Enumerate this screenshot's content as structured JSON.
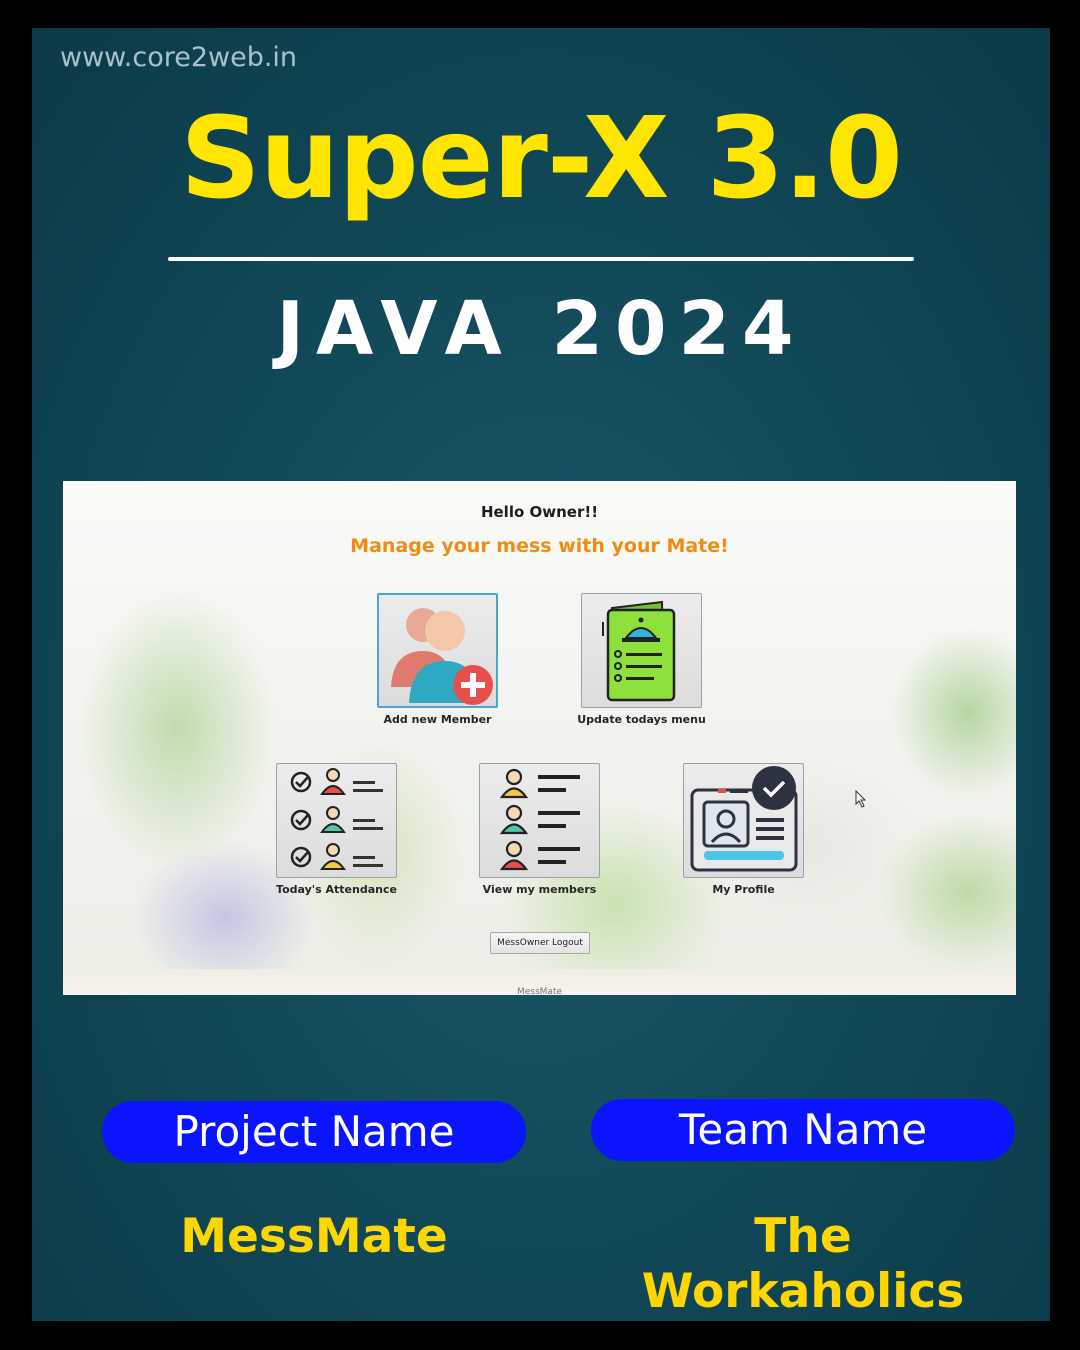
{
  "poster": {
    "website": "www.core2web.in",
    "title": "Super-X 3.0",
    "subtitle": "JAVA 2024"
  },
  "app": {
    "greeting": "Hello Owner!!",
    "tagline": "Manage your mess with your Mate!",
    "tiles": [
      {
        "label": "Add new Member",
        "icon": "add-member-icon"
      },
      {
        "label": "Update todays menu",
        "icon": "menu-card-icon"
      },
      {
        "label": "Today's Attendance",
        "icon": "attendance-checklist-icon"
      },
      {
        "label": "View my members",
        "icon": "members-list-icon"
      },
      {
        "label": "My Profile",
        "icon": "profile-card-icon"
      }
    ],
    "logout_label": "MessOwner Logout",
    "footer": "MessMate"
  },
  "info": {
    "project_label": "Project Name",
    "project_value": "MessMate",
    "team_label": "Team Name",
    "team_value": "The Workaholics"
  },
  "colors": {
    "title_yellow": "#ffe500",
    "value_yellow": "#ffd600",
    "pill_blue": "#0a14ff",
    "background_teal": "#124a5a",
    "tagline_orange": "#f28c0f"
  }
}
